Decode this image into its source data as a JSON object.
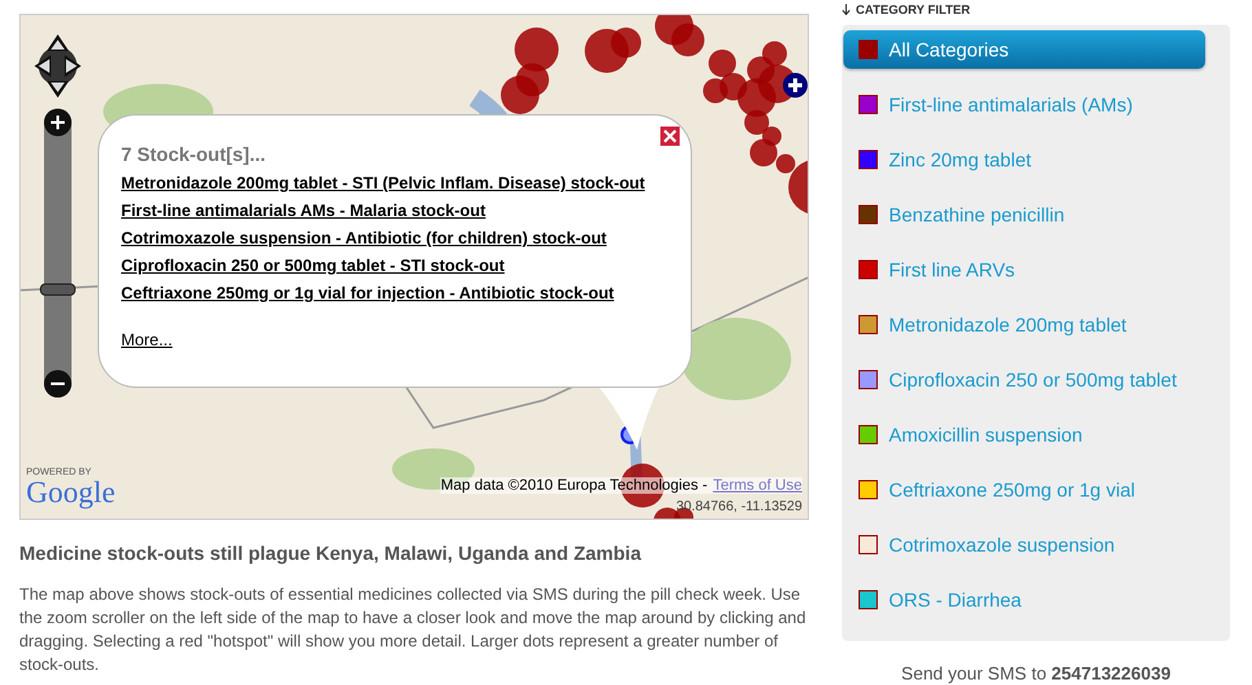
{
  "map": {
    "zoom": {
      "level": 0.38
    },
    "popup": {
      "title": "7 Stock-out[s]...",
      "links": [
        "Metronidazole 200mg tablet - STI (Pelvic Inflam. Disease) stock-out",
        "First-line antimalarials AMs - Malaria stock-out",
        "Cotrimoxazole suspension - Antibiotic (for children) stock-out",
        "Ciprofloxacin 250 or 500mg tablet - STI stock-out",
        "Ceftriaxone 250mg or 1g vial for injection - Antibiotic stock-out"
      ],
      "more": "More..."
    },
    "logo": {
      "powered_by": "POWERED BY",
      "wordmark": "Google"
    },
    "attribution": {
      "text": "Map data ©2010 Europa Technologies -",
      "link": "Terms of Use"
    },
    "coordinates": "30.84766, -11.13529"
  },
  "article": {
    "title": "Medicine stock-outs still plague Kenya, Malawi, Uganda and Zambia",
    "body": "The map above shows stock-outs of essential medicines collected via SMS during the pill check week. Use the zoom scroller on the left side of the map to have a closer look and move the map around by clicking and dragging. Selecting a red \"hotspot\" will show you more detail. Larger dots represent a greater number of stock-outs."
  },
  "sidebar": {
    "heading": "CATEGORY FILTER",
    "categories": [
      {
        "label": "All Categories",
        "color": "#990000",
        "selected": true
      },
      {
        "label": "First-line antimalarials (AMs)",
        "color": "#9900cc",
        "selected": false
      },
      {
        "label": "Zinc 20mg tablet",
        "color": "#3300ff",
        "selected": false
      },
      {
        "label": "Benzathine penicillin",
        "color": "#663300",
        "selected": false
      },
      {
        "label": "First line ARVs",
        "color": "#cc0000",
        "selected": false
      },
      {
        "label": "Metronidazole 200mg tablet",
        "color": "#cc9933",
        "selected": false
      },
      {
        "label": "Ciprofloxacin 250 or 500mg tablet",
        "color": "#9999ff",
        "selected": false
      },
      {
        "label": "Amoxicillin suspension",
        "color": "#66cc00",
        "selected": false
      },
      {
        "label": "Ceftriaxone 250mg or 1g vial",
        "color": "#ffcc00",
        "selected": false
      },
      {
        "label": "Cotrimoxazole suspension",
        "color": "#f8e9d8",
        "selected": false
      },
      {
        "label": "ORS - Diarrhea",
        "color": "#19c6cf",
        "selected": false
      }
    ]
  },
  "sms": {
    "prefix": "Send your SMS to",
    "number": "254713226039"
  }
}
